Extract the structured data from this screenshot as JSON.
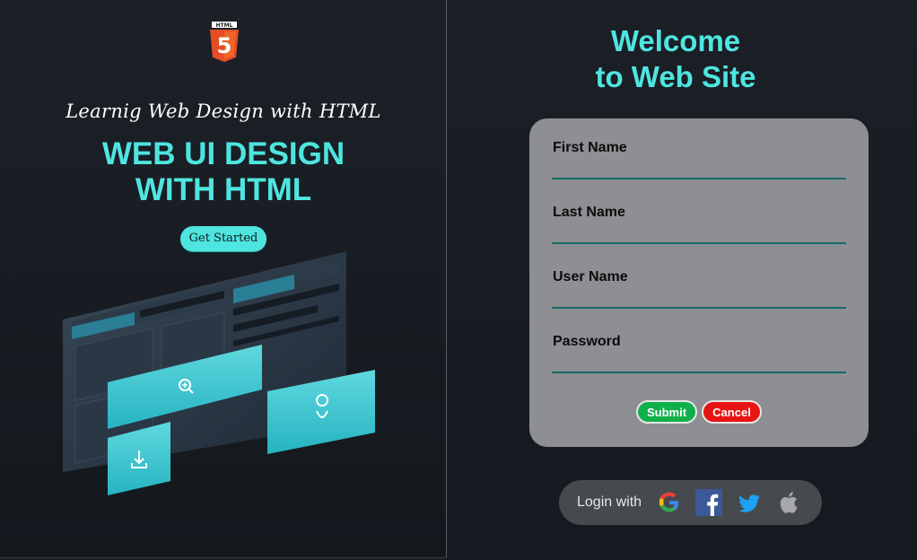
{
  "left": {
    "tagline": "Learnig Web Design with HTML",
    "title_line1": "WEB UI DESIGN",
    "title_line2": "WITH HTML",
    "cta_label": "Get Started",
    "logo_text": "HTML",
    "logo_number": "5"
  },
  "right": {
    "welcome_line1": "Welcome",
    "welcome_line2": "to Web Site",
    "form": {
      "fields": [
        {
          "label": "First Name",
          "value": "",
          "type": "text"
        },
        {
          "label": "Last Name",
          "value": "",
          "type": "text"
        },
        {
          "label": "User Name",
          "value": "",
          "type": "text"
        },
        {
          "label": "Password",
          "value": "",
          "type": "password"
        }
      ],
      "submit_label": "Submit",
      "cancel_label": "Cancel"
    },
    "social": {
      "label": "Login with",
      "icons": [
        "google-icon",
        "facebook-icon",
        "twitter-icon",
        "apple-icon"
      ]
    }
  },
  "colors": {
    "accent": "#4ee5e0",
    "form_bg": "#8d8f93",
    "submit": "#0fb04a",
    "cancel": "#e81414",
    "input_underline": "#166b6a"
  }
}
